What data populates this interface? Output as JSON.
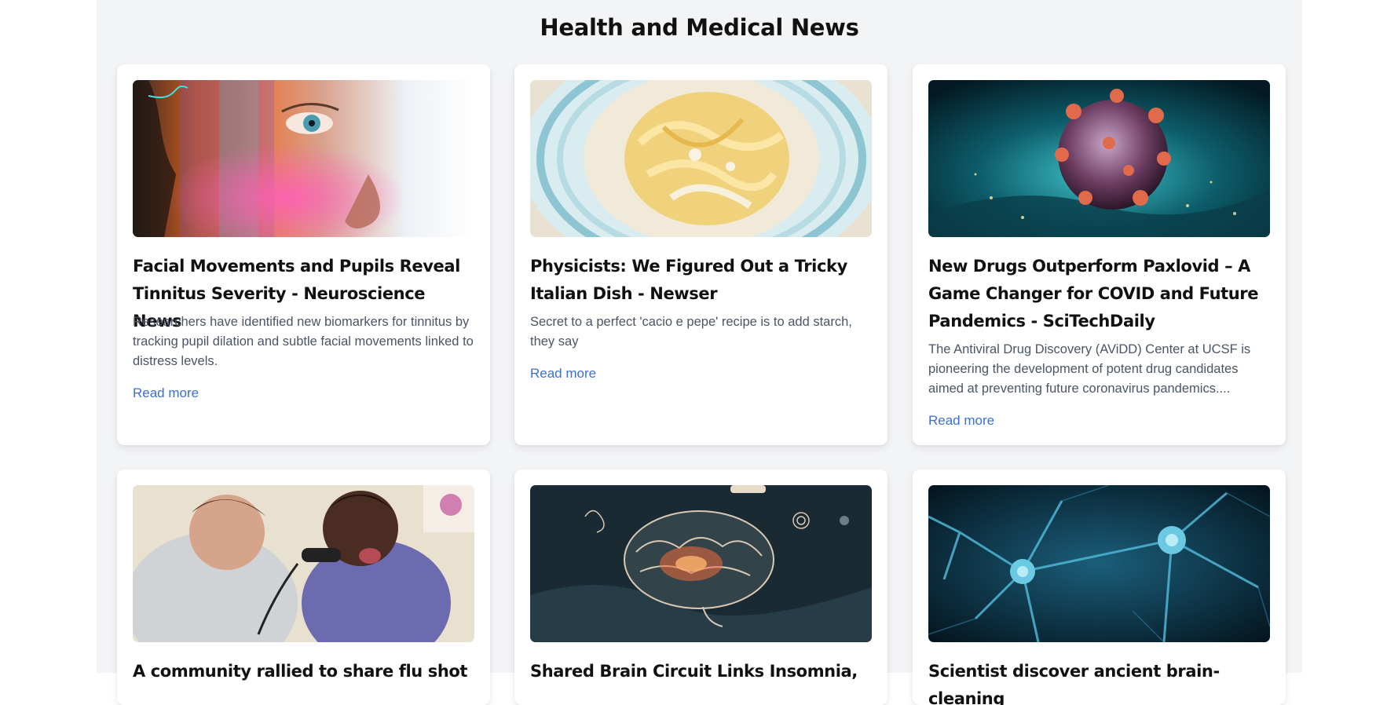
{
  "page": {
    "title": "Health and Medical News"
  },
  "colors": {
    "background": "#f3f4f6",
    "card": "#ffffff",
    "title": "#111111",
    "description": "#4b5563",
    "link": "#3b6fd9"
  },
  "cards": [
    {
      "title": "Facial Movements and Pupils Reveal Tinnitus Severity - Neuroscience News",
      "description": "Researchers have identified new biomarkers for tinnitus by tracking pupil dilation and subtle facial movements linked to distress levels.",
      "link_label": "Read more",
      "image": "face-closeup-image"
    },
    {
      "title": "Physicists: We Figured Out a Tricky Italian Dish - Newser",
      "description": "Secret to a perfect 'cacio e pepe' recipe is to add starch, they say",
      "link_label": "Read more",
      "image": "pasta-bowl-image"
    },
    {
      "title": "New Drugs Outperform Paxlovid – A Game Changer for COVID and Future Pandemics - SciTechDaily",
      "description": "The Antiviral Drug Discovery (AViDD) Center at UCSF is pioneering the development of potent drug candidates aimed at preventing future coronavirus pandemics....",
      "link_label": "Read more",
      "image": "virus-particle-image"
    },
    {
      "title": "A community rallied to share flu shot",
      "description": "",
      "link_label": "",
      "image": "doctor-exam-image"
    },
    {
      "title": "Shared Brain Circuit Links Insomnia,",
      "description": "",
      "link_label": "",
      "image": "brain-illustration-image"
    },
    {
      "title": "Scientist discover ancient brain-cleaning",
      "description": "",
      "link_label": "",
      "image": "neurons-image"
    }
  ]
}
